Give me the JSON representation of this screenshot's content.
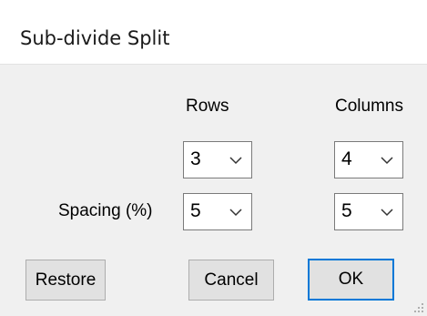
{
  "window": {
    "title": "Sub-divide Split"
  },
  "headers": {
    "rows": "Rows",
    "columns": "Columns"
  },
  "labels": {
    "spacing": "Spacing (%)"
  },
  "fields": {
    "rows_count": "3",
    "columns_count": "4",
    "row_spacing": "5",
    "column_spacing": "5"
  },
  "buttons": {
    "restore": "Restore",
    "cancel": "Cancel",
    "ok": "OK"
  },
  "colors": {
    "default_button_border": "#0078d7",
    "dialog_background": "#f0f0f0"
  }
}
